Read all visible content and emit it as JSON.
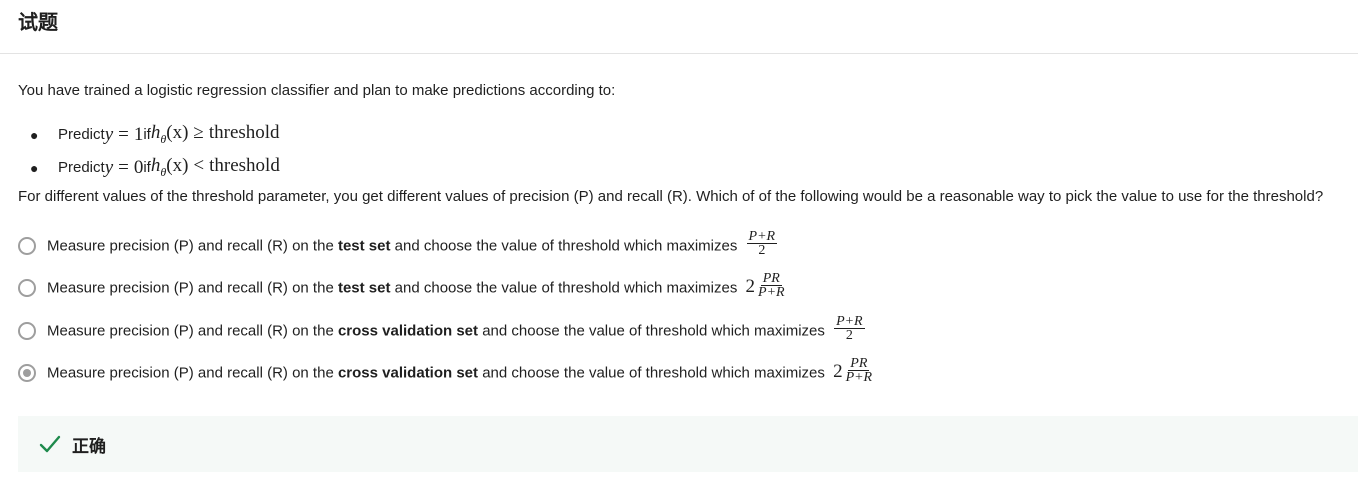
{
  "header": {
    "title": "试题"
  },
  "question": {
    "intro": "You have trained a logistic regression classifier and plan to make predictions according to:",
    "bullets": [
      {
        "prefix": "Predict ",
        "var": "y",
        "eq": "=",
        "val": "1",
        "mid": " if ",
        "fn": "h",
        "sub": "θ",
        "arg": "(x)",
        "op": "≥",
        "word": "threshold"
      },
      {
        "prefix": "Predict ",
        "var": "y",
        "eq": "=",
        "val": "0",
        "mid": " if ",
        "fn": "h",
        "sub": "θ",
        "arg": "(x)",
        "op": "<",
        "word": "threshold"
      }
    ],
    "prompt": "For different values of the threshold parameter, you get different values of precision (P) and recall (R). Which of of the following would be a reasonable way to pick the value to use for the threshold?"
  },
  "options": [
    {
      "pre": "Measure precision (P) and recall (R) on the ",
      "bold": "test set",
      "post": " and choose the value of threshold which maximizes",
      "coef": "",
      "num": "P+R",
      "den": "2",
      "selected": false
    },
    {
      "pre": "Measure precision (P) and recall (R) on the ",
      "bold": "test set",
      "post": " and choose the value of threshold which maximizes",
      "coef": "2",
      "num": "PR",
      "den": "P+R",
      "selected": false
    },
    {
      "pre": "Measure precision (P) and recall (R) on the ",
      "bold": "cross validation set",
      "post": " and choose the value of threshold which maximizes",
      "coef": "",
      "num": "P+R",
      "den": "2",
      "selected": false
    },
    {
      "pre": "Measure precision (P) and recall (R) on the ",
      "bold": "cross validation set",
      "post": " and choose the value of threshold which maximizes",
      "coef": "2",
      "num": "PR",
      "den": "P+R",
      "selected": true
    }
  ],
  "feedback": {
    "text": "正确",
    "icon": "checkmark-icon",
    "icon_color": "#1e8a4c",
    "bg_color": "#f5f9f7"
  }
}
